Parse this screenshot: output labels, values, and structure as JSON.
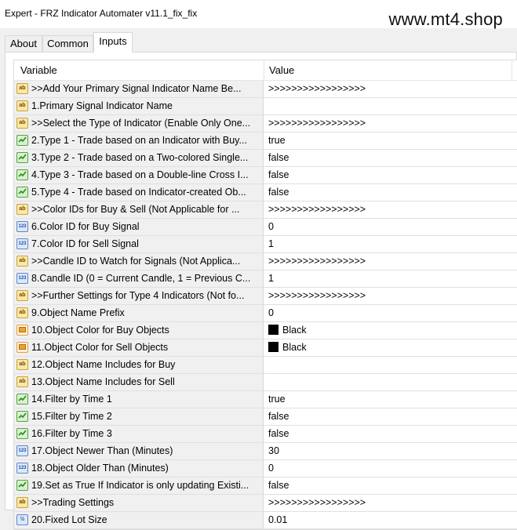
{
  "window": {
    "title": "Expert - FRZ Indicator Automater v11.1_fix_fix",
    "watermark": "www.mt4.shop"
  },
  "tabs": [
    {
      "label": "About",
      "active": false
    },
    {
      "label": "Common",
      "active": false
    },
    {
      "label": "Inputs",
      "active": true
    }
  ],
  "grid": {
    "columns": {
      "variable": "Variable",
      "value": "Value"
    },
    "rows": [
      {
        "type": "string",
        "name": ">>Add Your Primary Signal Indicator Name Be...",
        "value": ">>>>>>>>>>>>>>>>>"
      },
      {
        "type": "string",
        "name": "1.Primary Signal Indicator Name",
        "value": ""
      },
      {
        "type": "string",
        "name": ">>Select the Type of Indicator (Enable Only One...",
        "value": ">>>>>>>>>>>>>>>>>"
      },
      {
        "type": "bool",
        "name": "2.Type 1 - Trade based on an Indicator with Buy...",
        "value": "true"
      },
      {
        "type": "bool",
        "name": "3.Type 2 - Trade based on a Two-colored Single...",
        "value": "false"
      },
      {
        "type": "bool",
        "name": "4.Type 3 - Trade based on a Double-line Cross I...",
        "value": "false"
      },
      {
        "type": "bool",
        "name": "5.Type 4 - Trade based on Indicator-created Ob...",
        "value": "false"
      },
      {
        "type": "string",
        "name": ">>Color IDs for Buy & Sell (Not Applicable for ...",
        "value": ">>>>>>>>>>>>>>>>>"
      },
      {
        "type": "int",
        "name": "6.Color ID for Buy Signal",
        "value": "0"
      },
      {
        "type": "int",
        "name": "7.Color ID for Sell Signal",
        "value": "1"
      },
      {
        "type": "string",
        "name": ">>Candle ID to Watch for Signals  (Not Applica...",
        "value": ">>>>>>>>>>>>>>>>>"
      },
      {
        "type": "int",
        "name": "8.Candle ID (0 = Current Candle, 1 = Previous C...",
        "value": "1"
      },
      {
        "type": "string",
        "name": ">>Further Settings for Type 4 Indicators (Not fo...",
        "value": ">>>>>>>>>>>>>>>>>"
      },
      {
        "type": "string",
        "name": "9.Object Name Prefix",
        "value": "0"
      },
      {
        "type": "color",
        "name": "10.Object Color for Buy Objects",
        "value": "Black",
        "swatch": "#000000"
      },
      {
        "type": "color",
        "name": "11.Object Color for Sell Objects",
        "value": "Black",
        "swatch": "#000000"
      },
      {
        "type": "string",
        "name": "12.Object Name Includes for Buy",
        "value": ""
      },
      {
        "type": "string",
        "name": "13.Object Name Includes for Sell",
        "value": ""
      },
      {
        "type": "bool",
        "name": "14.Filter by Time 1",
        "value": "true"
      },
      {
        "type": "bool",
        "name": "15.Filter by Time 2",
        "value": "false"
      },
      {
        "type": "bool",
        "name": "16.Filter by Time 3",
        "value": "false"
      },
      {
        "type": "int",
        "name": "17.Object Newer Than (Minutes)",
        "value": "30"
      },
      {
        "type": "int",
        "name": "18.Object Older Than (Minutes)",
        "value": "0"
      },
      {
        "type": "bool",
        "name": "19.Set as True If Indicator is only updating Existi...",
        "value": "false"
      },
      {
        "type": "string",
        "name": ">>Trading Settings",
        "value": ">>>>>>>>>>>>>>>>>"
      },
      {
        "type": "double",
        "name": "20.Fixed Lot Size",
        "value": "0.01"
      }
    ]
  },
  "icons": {
    "string": "ab-string-icon",
    "bool": "boolean-chart-icon",
    "int": "123-integer-icon",
    "color": "color-icon",
    "double": "fraction-double-icon"
  }
}
